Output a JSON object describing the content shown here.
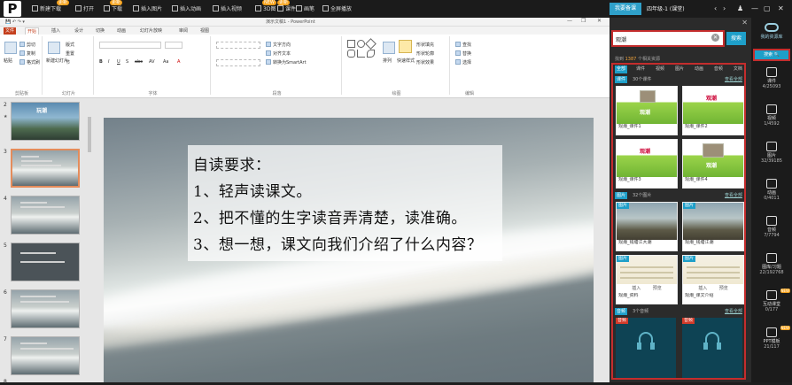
{
  "topbar": {
    "logo": "P",
    "items": [
      {
        "label": "新建下载",
        "badge": "更新"
      },
      {
        "label": "打开"
      },
      {
        "label": "下载",
        "badge": "更新"
      },
      {
        "label": "插入图片"
      },
      {
        "label": "插入动画"
      },
      {
        "label": "插入视频"
      },
      {
        "label": "3D图",
        "badge": "NEW"
      },
      {
        "label": "课件",
        "badge": "更新"
      },
      {
        "label": "画笔"
      },
      {
        "label": "全屏播放"
      }
    ],
    "grade_button": "我要备课",
    "grade_label": "四年级-1 (课堂)",
    "right_icons": [
      "‹",
      "›",
      "♟",
      "—",
      "▢",
      "✕"
    ]
  },
  "ppt": {
    "title": "演示文稿1 - PowerPoint",
    "qat": "💾 ↶ ↷ ▾",
    "window_controls": [
      "—",
      "❐",
      "✕"
    ],
    "tabs": [
      "文件",
      "开始",
      "插入",
      "设计",
      "切换",
      "动画",
      "幻灯片放映",
      "审阅",
      "视图"
    ],
    "active_tab": "开始",
    "ribbon_groups": [
      {
        "label": "剪贴板",
        "buttons": [
          "粘贴",
          "剪切",
          "复制",
          "格式刷"
        ]
      },
      {
        "label": "幻灯片",
        "buttons": [
          "新建幻灯片",
          "版式",
          "重置",
          "节"
        ]
      },
      {
        "label": "字体",
        "buttons": [
          "B",
          "I",
          "U",
          "S",
          "abc",
          "AV",
          "Aa",
          "A"
        ]
      },
      {
        "label": "段落",
        "buttons": [
          "文字方向",
          "对齐文本",
          "转换为SmartArt"
        ]
      },
      {
        "label": "绘图",
        "buttons": [
          "排列",
          "快速样式",
          "形状填充",
          "形状轮廓",
          "形状效果"
        ]
      },
      {
        "label": "编辑",
        "buttons": [
          "查找",
          "替换",
          "选择"
        ]
      }
    ]
  },
  "thumbnails": [
    {
      "num": "2",
      "title": "玩潮"
    },
    {
      "num": "3"
    },
    {
      "num": "4"
    },
    {
      "num": "5"
    },
    {
      "num": "6"
    },
    {
      "num": "7"
    },
    {
      "num": "8"
    }
  ],
  "slide": {
    "lines": [
      "自读要求：",
      "1、轻声读课文。",
      "2、把不懂的生字读音弄清楚，读准确。",
      "3、想一想，课文向我们介绍了什么内容？"
    ]
  },
  "resource_panel": {
    "search_value": "观潮",
    "search_button": "搜索",
    "summary_prefix": "找到",
    "summary_count": "1387",
    "summary_suffix": "个相关资源",
    "filters": [
      "全部",
      "课件",
      "视频",
      "图片",
      "动画",
      "音频",
      "文档"
    ],
    "active_filter": "全部",
    "sections": [
      {
        "tag": "课件",
        "count": "30个课件",
        "more": "查看全部",
        "cards": [
          {
            "title": "观潮",
            "label": "观潮_课件1",
            "style": "green"
          },
          {
            "title": "观潮",
            "label": "观潮_课件2",
            "style": "green"
          },
          {
            "title": "观潮",
            "label": "观潮_课件3",
            "style": "green"
          },
          {
            "title": "观潮",
            "label": "观潮_课件4",
            "style": "green"
          }
        ]
      },
      {
        "tag": "图片",
        "count": "32个图片",
        "more": "查看全部",
        "cards": [
          {
            "tag": "图片",
            "label": "观潮_钱塘江大潮",
            "style": "photo"
          },
          {
            "tag": "图片",
            "label": "观潮_钱塘江潮",
            "style": "photo"
          },
          {
            "tag": "图片",
            "label": "观潮_资料",
            "style": "paper",
            "btns": [
              "插入",
              "预览"
            ]
          },
          {
            "tag": "图片",
            "label": "观潮_课文介绍",
            "style": "paper",
            "btns": [
              "插入",
              "预览"
            ]
          }
        ]
      },
      {
        "tag": "音频",
        "count": "3个音频",
        "more": "查看全部",
        "cards": [
          {
            "tag": "音频",
            "style": "dark"
          },
          {
            "tag": "音频",
            "style": "dark"
          }
        ]
      }
    ]
  },
  "sidebar": {
    "top_label": "我的资源库",
    "search_label": "搜索 🔍",
    "items": [
      {
        "label": "课件",
        "count": "4/25093"
      },
      {
        "label": "视频",
        "count": "1/4592"
      },
      {
        "label": "图片",
        "count": "32/39185"
      },
      {
        "label": "动画",
        "count": "0/4011"
      },
      {
        "label": "音频",
        "count": "7/7794"
      },
      {
        "label": "图库/习题",
        "count": "22/192768"
      },
      {
        "label": "互动课堂",
        "count": "0/177",
        "badge": "NEW"
      },
      {
        "label": "PPT模板",
        "count": "21/117",
        "badge": "NEW"
      }
    ]
  },
  "colors": {
    "accent": "#1e9fc9",
    "highlight": "#c42d2d",
    "ppt_orange": "#c43e1c",
    "badge": "#f7a21b"
  }
}
